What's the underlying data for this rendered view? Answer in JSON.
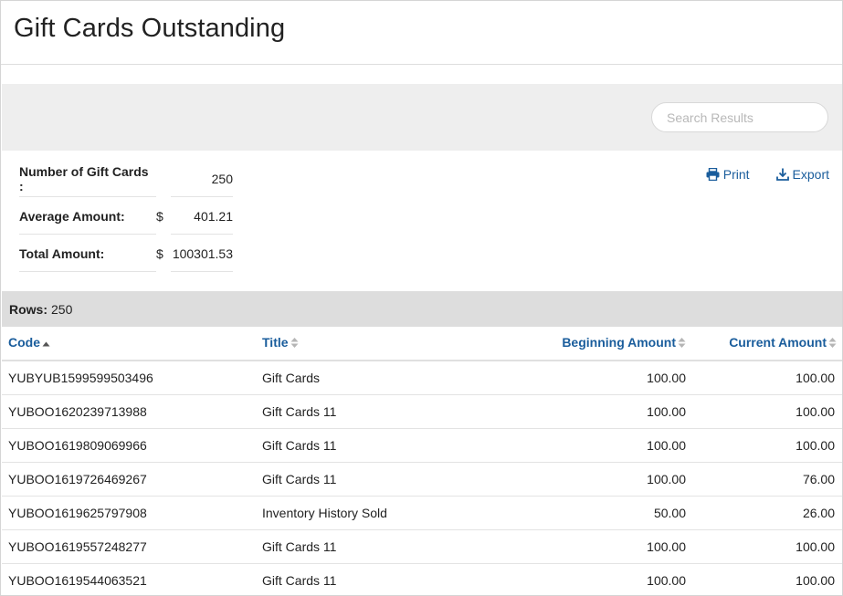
{
  "page": {
    "title": "Gift Cards Outstanding"
  },
  "search": {
    "placeholder": "Search Results",
    "value": ""
  },
  "summary": {
    "count_label": "Number of Gift Cards :",
    "count_value": "250",
    "avg_label": "Average Amount:",
    "avg_currency": "$",
    "avg_value": "401.21",
    "total_label": "Total Amount:",
    "total_currency": "$",
    "total_value": "100301.53"
  },
  "actions": {
    "print_label": "Print",
    "export_label": "Export"
  },
  "rows_bar": {
    "label": "Rows:",
    "value": "250"
  },
  "table": {
    "columns": [
      {
        "label": "Code",
        "sort": "asc"
      },
      {
        "label": "Title",
        "sort": "none"
      },
      {
        "label": "Beginning Amount",
        "sort": "none"
      },
      {
        "label": "Current Amount",
        "sort": "none"
      }
    ],
    "rows": [
      [
        "YUBYUB1599599503496",
        "Gift Cards",
        "100.00",
        "100.00"
      ],
      [
        "YUBOO1620239713988",
        "Gift Cards 11",
        "100.00",
        "100.00"
      ],
      [
        "YUBOO1619809069966",
        "Gift Cards 11",
        "100.00",
        "100.00"
      ],
      [
        "YUBOO1619726469267",
        "Gift Cards 11",
        "100.00",
        "76.00"
      ],
      [
        "YUBOO1619625797908",
        "Inventory History Sold",
        "50.00",
        "26.00"
      ],
      [
        "YUBOO1619557248277",
        "Gift Cards 11",
        "100.00",
        "100.00"
      ],
      [
        "YUBOO1619544063521",
        "Gift Cards 11",
        "100.00",
        "100.00"
      ]
    ]
  },
  "colors": {
    "link": "#1a5d9c",
    "band": "#eeeeee",
    "rows_bar": "#dddddd",
    "sort_inactive": "#b5b5b5"
  },
  "icons": {
    "print": "printer-icon",
    "export": "download-icon",
    "sort_asc": "sort-asc-icon",
    "sort_both": "sort-icon"
  }
}
